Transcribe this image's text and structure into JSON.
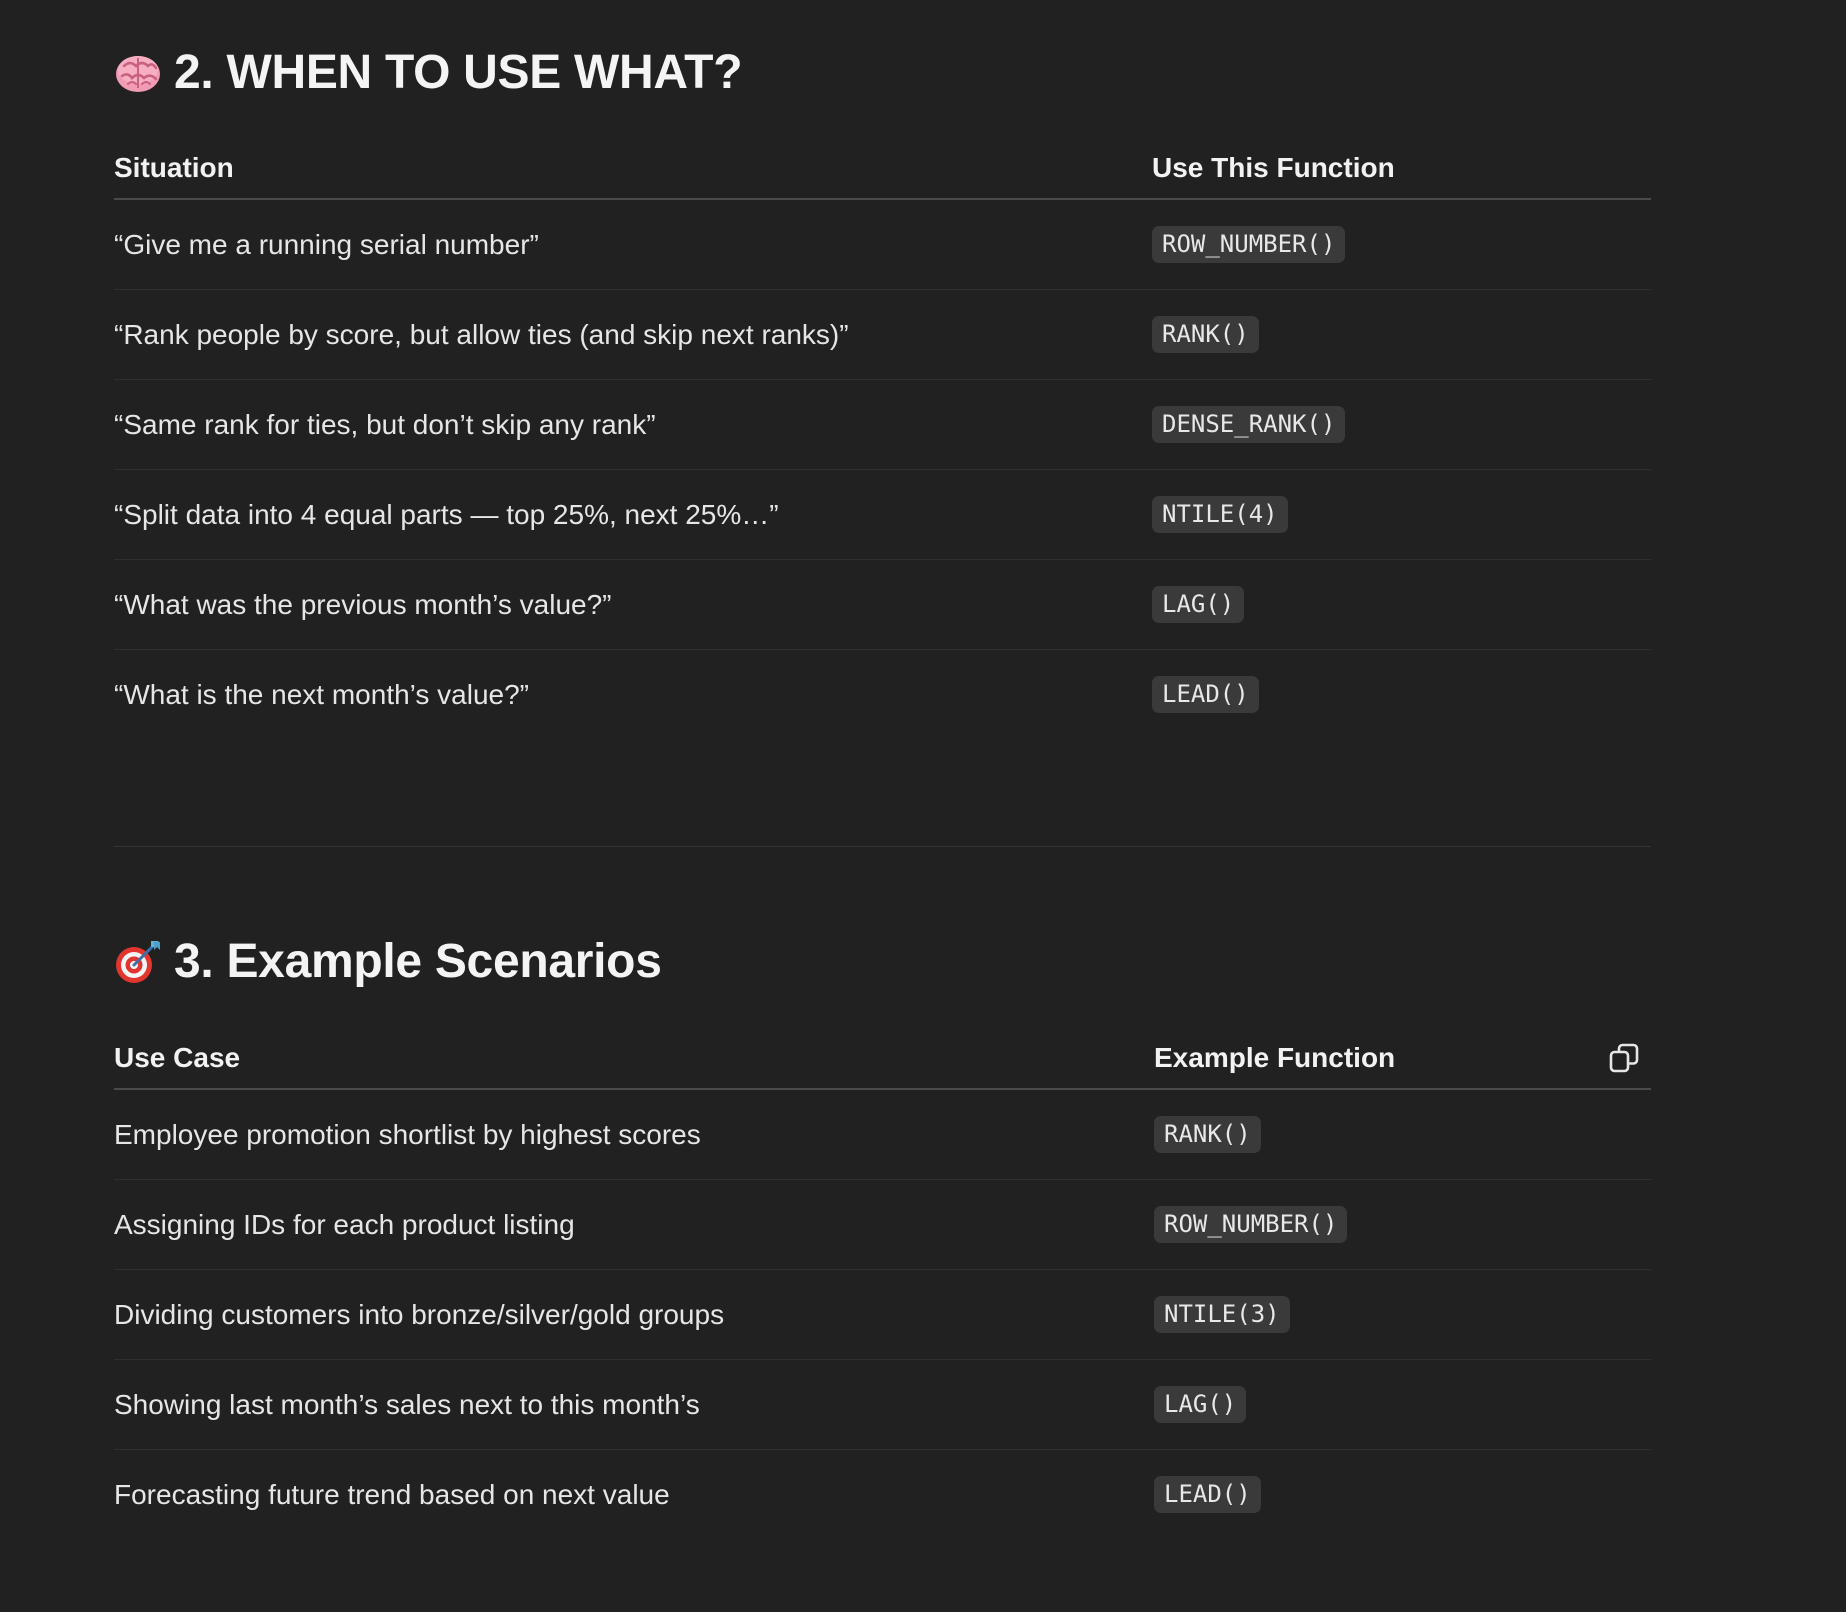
{
  "section1": {
    "emoji": "brain-icon",
    "title": "2. WHEN TO USE WHAT?",
    "headers": [
      "Situation",
      "Use This Function"
    ],
    "rows": [
      {
        "situation": "“Give me a running serial number”",
        "function": "ROW_NUMBER()"
      },
      {
        "situation": "“Rank people by score, but allow ties (and skip next ranks)”",
        "function": "RANK()"
      },
      {
        "situation": "“Same rank for ties, but don’t skip any rank”",
        "function": "DENSE_RANK()"
      },
      {
        "situation": "“Split data into 4 equal parts — top 25%, next 25%…”",
        "function": "NTILE(4)"
      },
      {
        "situation": "“What was the previous month’s value?”",
        "function": "LAG()"
      },
      {
        "situation": "“What is the next month’s value?”",
        "function": "LEAD()"
      }
    ]
  },
  "section2": {
    "emoji": "dart-target-icon",
    "title": "3. Example Scenarios",
    "headers": [
      "Use Case",
      "Example Function"
    ],
    "copy_icon": "copy-icon",
    "rows": [
      {
        "use_case": "Employee promotion shortlist by highest scores",
        "function": "RANK()"
      },
      {
        "use_case": "Assigning IDs for each product listing",
        "function": "ROW_NUMBER()"
      },
      {
        "use_case": "Dividing customers into bronze/silver/gold groups",
        "function": "NTILE(3)"
      },
      {
        "use_case": "Showing last month’s sales next to this month’s",
        "function": "LAG()"
      },
      {
        "use_case": "Forecasting future trend based on next value",
        "function": "LEAD()"
      }
    ]
  },
  "colors": {
    "background": "#212121",
    "text": "#ececec",
    "code_bg": "#3a3a3a",
    "divider": "#343434"
  }
}
